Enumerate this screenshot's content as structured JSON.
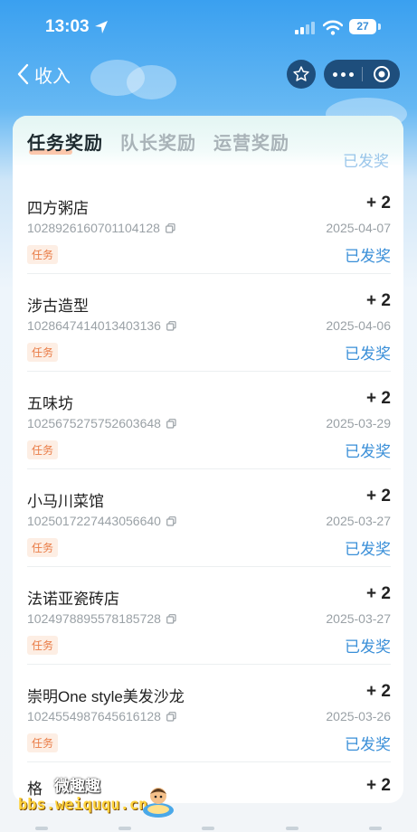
{
  "status_bar": {
    "time": "13:03",
    "battery": "27"
  },
  "nav": {
    "back_label": "收入"
  },
  "tabs": [
    {
      "label": "任务奖励",
      "active": true
    },
    {
      "label": "队长奖励",
      "active": false
    },
    {
      "label": "运营奖励",
      "active": false
    }
  ],
  "peek_prev_status": "已发奖",
  "items": [
    {
      "name": "四方粥店",
      "amount": "+ 2",
      "id": "1028926160701104128",
      "date": "2025-04-07",
      "tag": "任务",
      "status": "已发奖"
    },
    {
      "name": "涉古造型",
      "amount": "+ 2",
      "id": "1028647414013403136",
      "date": "2025-04-06",
      "tag": "任务",
      "status": "已发奖"
    },
    {
      "name": "五味坊",
      "amount": "+ 2",
      "id": "1025675275752603648",
      "date": "2025-03-29",
      "tag": "任务",
      "status": "已发奖"
    },
    {
      "name": "小马川菜馆",
      "amount": "+ 2",
      "id": "1025017227443056640",
      "date": "2025-03-27",
      "tag": "任务",
      "status": "已发奖"
    },
    {
      "name": "法诺亚瓷砖店",
      "amount": "+ 2",
      "id": "1024978895578185728",
      "date": "2025-03-27",
      "tag": "任务",
      "status": "已发奖"
    },
    {
      "name": "崇明One style美发沙龙",
      "amount": "+ 2",
      "id": "1024554987645616128",
      "date": "2025-03-26",
      "tag": "任务",
      "status": "已发奖"
    }
  ],
  "peek_next": {
    "name": "格",
    "amount": "+ 2"
  },
  "watermark": {
    "title": "微趣趣",
    "url": "bbs.weiququ.cn"
  },
  "colors": {
    "accent": "#3a8fd8",
    "tag_text": "#e97b45",
    "tag_bg": "#fdeee4",
    "capsule": "#1e4e7c"
  }
}
